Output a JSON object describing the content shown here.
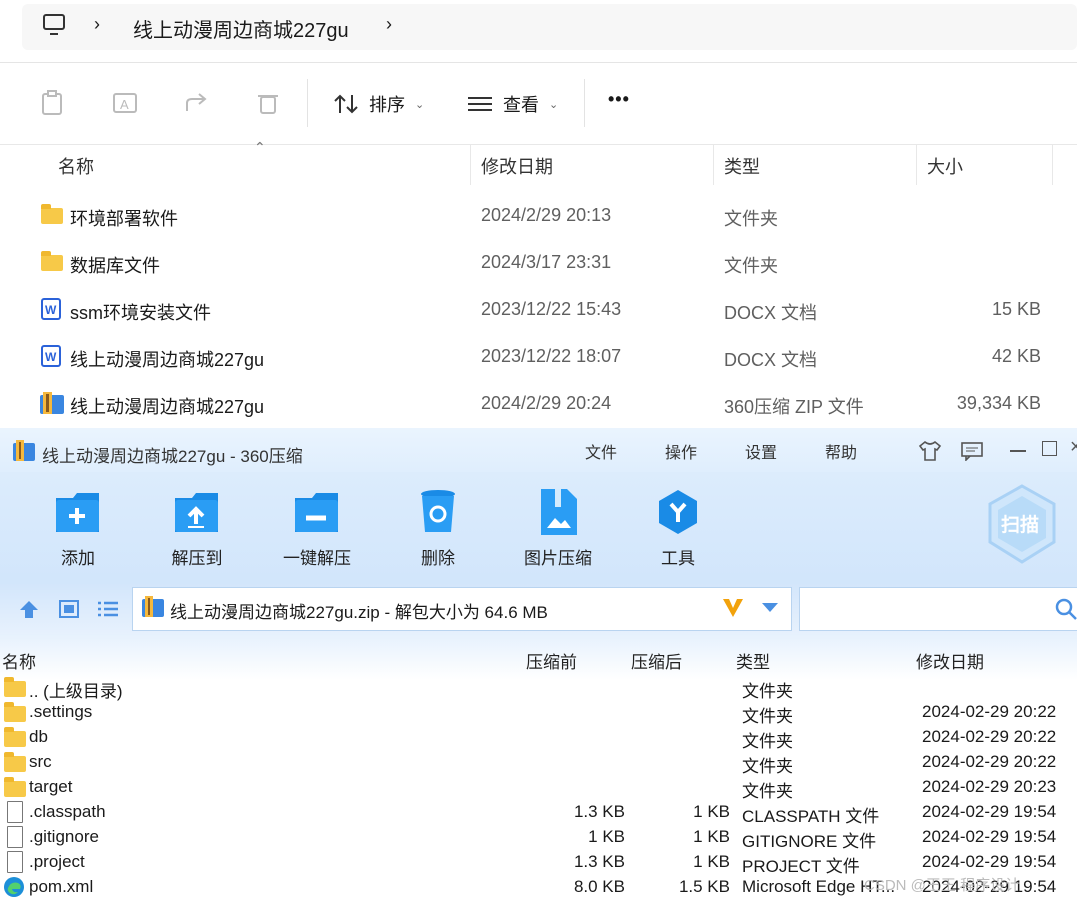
{
  "explorer": {
    "breadcrumb": {
      "path": "线上动漫周边商城227gu"
    },
    "toolbar": {
      "sort_label": "排序",
      "view_label": "查看",
      "more_label": "•••"
    },
    "columns": [
      "名称",
      "修改日期",
      "类型",
      "大小"
    ],
    "rows": [
      {
        "name": "环境部署软件",
        "date": "2024/2/29 20:13",
        "type": "文件夹",
        "size": "",
        "icon": "folder-icon"
      },
      {
        "name": "数据库文件",
        "date": "2024/3/17 23:31",
        "type": "文件夹",
        "size": "",
        "icon": "folder-icon"
      },
      {
        "name": "ssm环境安装文件",
        "date": "2023/12/22 15:43",
        "type": "DOCX 文档",
        "size": "15 KB",
        "icon": "word-doc-icon"
      },
      {
        "name": "线上动漫周边商城227gu",
        "date": "2023/12/22 18:07",
        "type": "DOCX 文档",
        "size": "42 KB",
        "icon": "word-doc-icon"
      },
      {
        "name": "线上动漫周边商城227gu",
        "date": "2024/2/29 20:24",
        "type": "360压缩 ZIP 文件",
        "size": "39,334 KB",
        "icon": "zip-archive-icon"
      }
    ]
  },
  "zip": {
    "title": "线上动漫周边商城227gu - 360压缩",
    "menu": [
      "文件",
      "操作",
      "设置",
      "帮助"
    ],
    "tools": [
      "添加",
      "解压到",
      "一键解压",
      "删除",
      "图片压缩",
      "工具"
    ],
    "scan_label": "扫描",
    "path": "线上动漫周边商城227gu.zip - 解包大小为 64.6 MB",
    "columns": [
      "名称",
      "压缩前",
      "压缩后",
      "类型",
      "修改日期"
    ],
    "rows": [
      {
        "name": ".. (上级目录)",
        "before": "",
        "after": "",
        "type": "文件夹",
        "date": "",
        "icon": "folder-icon"
      },
      {
        "name": ".settings",
        "before": "",
        "after": "",
        "type": "文件夹",
        "date": "2024-02-29 20:22",
        "icon": "folder-icon"
      },
      {
        "name": "db",
        "before": "",
        "after": "",
        "type": "文件夹",
        "date": "2024-02-29 20:22",
        "icon": "folder-icon"
      },
      {
        "name": "src",
        "before": "",
        "after": "",
        "type": "文件夹",
        "date": "2024-02-29 20:22",
        "icon": "folder-icon"
      },
      {
        "name": "target",
        "before": "",
        "after": "",
        "type": "文件夹",
        "date": "2024-02-29 20:23",
        "icon": "folder-icon"
      },
      {
        "name": ".classpath",
        "before": "1.3 KB",
        "after": "1 KB",
        "type": "CLASSPATH 文件",
        "date": "2024-02-29 19:54",
        "icon": "file-icon"
      },
      {
        "name": ".gitignore",
        "before": "1 KB",
        "after": "1 KB",
        "type": "GITIGNORE 文件",
        "date": "2024-02-29 19:54",
        "icon": "file-icon"
      },
      {
        "name": ".project",
        "before": "1.3 KB",
        "after": "1 KB",
        "type": "PROJECT 文件",
        "date": "2024-02-29 19:54",
        "icon": "file-icon"
      },
      {
        "name": "pom.xml",
        "before": "8.0 KB",
        "after": "1.5 KB",
        "type": "Microsoft Edge HT...",
        "date": "2024-02-29 19:54",
        "icon": "edge-icon"
      }
    ]
  },
  "watermark": "CSDN @王王 程序设计"
}
